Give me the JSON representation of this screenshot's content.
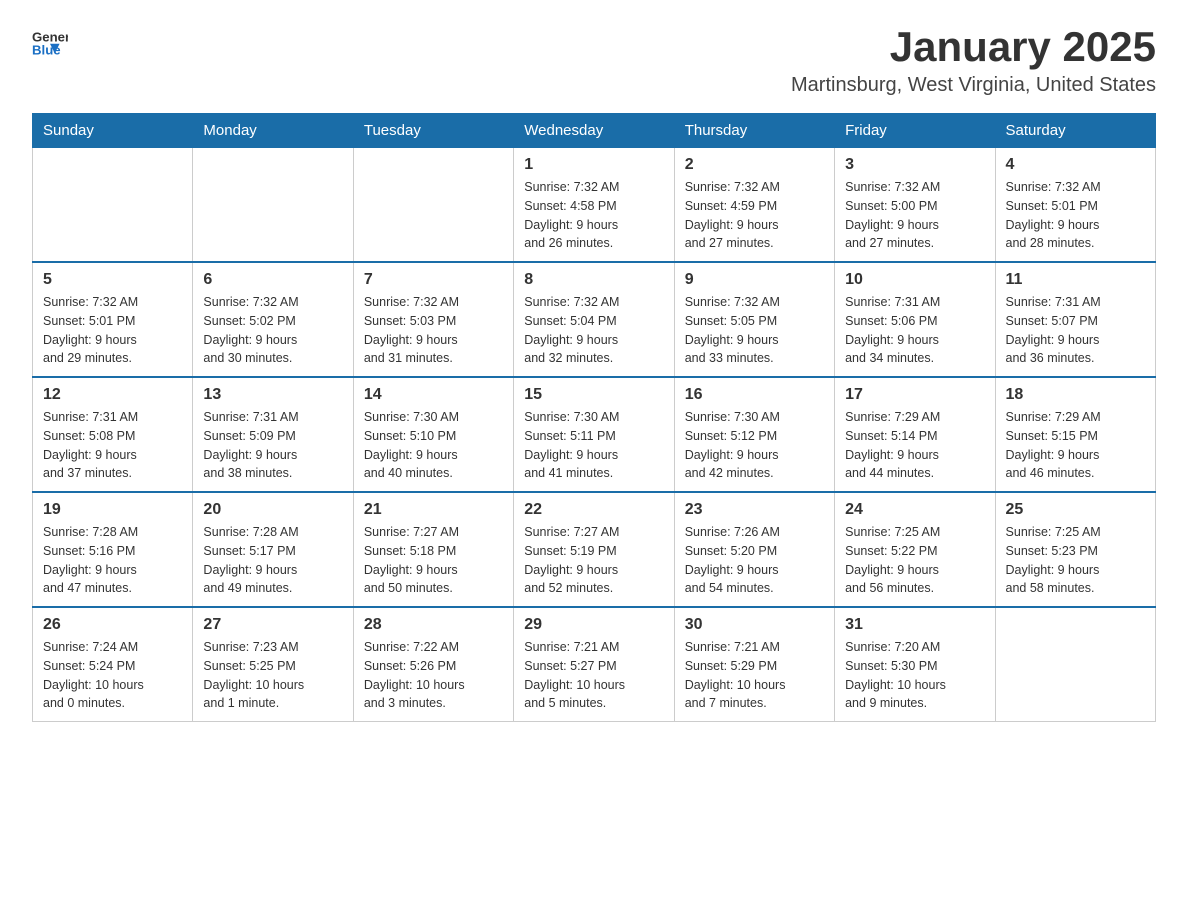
{
  "header": {
    "logo_general": "General",
    "logo_blue": "Blue",
    "month_title": "January 2025",
    "location": "Martinsburg, West Virginia, United States"
  },
  "weekdays": [
    "Sunday",
    "Monday",
    "Tuesday",
    "Wednesday",
    "Thursday",
    "Friday",
    "Saturday"
  ],
  "weeks": [
    [
      {
        "day": "",
        "info": ""
      },
      {
        "day": "",
        "info": ""
      },
      {
        "day": "",
        "info": ""
      },
      {
        "day": "1",
        "info": "Sunrise: 7:32 AM\nSunset: 4:58 PM\nDaylight: 9 hours\nand 26 minutes."
      },
      {
        "day": "2",
        "info": "Sunrise: 7:32 AM\nSunset: 4:59 PM\nDaylight: 9 hours\nand 27 minutes."
      },
      {
        "day": "3",
        "info": "Sunrise: 7:32 AM\nSunset: 5:00 PM\nDaylight: 9 hours\nand 27 minutes."
      },
      {
        "day": "4",
        "info": "Sunrise: 7:32 AM\nSunset: 5:01 PM\nDaylight: 9 hours\nand 28 minutes."
      }
    ],
    [
      {
        "day": "5",
        "info": "Sunrise: 7:32 AM\nSunset: 5:01 PM\nDaylight: 9 hours\nand 29 minutes."
      },
      {
        "day": "6",
        "info": "Sunrise: 7:32 AM\nSunset: 5:02 PM\nDaylight: 9 hours\nand 30 minutes."
      },
      {
        "day": "7",
        "info": "Sunrise: 7:32 AM\nSunset: 5:03 PM\nDaylight: 9 hours\nand 31 minutes."
      },
      {
        "day": "8",
        "info": "Sunrise: 7:32 AM\nSunset: 5:04 PM\nDaylight: 9 hours\nand 32 minutes."
      },
      {
        "day": "9",
        "info": "Sunrise: 7:32 AM\nSunset: 5:05 PM\nDaylight: 9 hours\nand 33 minutes."
      },
      {
        "day": "10",
        "info": "Sunrise: 7:31 AM\nSunset: 5:06 PM\nDaylight: 9 hours\nand 34 minutes."
      },
      {
        "day": "11",
        "info": "Sunrise: 7:31 AM\nSunset: 5:07 PM\nDaylight: 9 hours\nand 36 minutes."
      }
    ],
    [
      {
        "day": "12",
        "info": "Sunrise: 7:31 AM\nSunset: 5:08 PM\nDaylight: 9 hours\nand 37 minutes."
      },
      {
        "day": "13",
        "info": "Sunrise: 7:31 AM\nSunset: 5:09 PM\nDaylight: 9 hours\nand 38 minutes."
      },
      {
        "day": "14",
        "info": "Sunrise: 7:30 AM\nSunset: 5:10 PM\nDaylight: 9 hours\nand 40 minutes."
      },
      {
        "day": "15",
        "info": "Sunrise: 7:30 AM\nSunset: 5:11 PM\nDaylight: 9 hours\nand 41 minutes."
      },
      {
        "day": "16",
        "info": "Sunrise: 7:30 AM\nSunset: 5:12 PM\nDaylight: 9 hours\nand 42 minutes."
      },
      {
        "day": "17",
        "info": "Sunrise: 7:29 AM\nSunset: 5:14 PM\nDaylight: 9 hours\nand 44 minutes."
      },
      {
        "day": "18",
        "info": "Sunrise: 7:29 AM\nSunset: 5:15 PM\nDaylight: 9 hours\nand 46 minutes."
      }
    ],
    [
      {
        "day": "19",
        "info": "Sunrise: 7:28 AM\nSunset: 5:16 PM\nDaylight: 9 hours\nand 47 minutes."
      },
      {
        "day": "20",
        "info": "Sunrise: 7:28 AM\nSunset: 5:17 PM\nDaylight: 9 hours\nand 49 minutes."
      },
      {
        "day": "21",
        "info": "Sunrise: 7:27 AM\nSunset: 5:18 PM\nDaylight: 9 hours\nand 50 minutes."
      },
      {
        "day": "22",
        "info": "Sunrise: 7:27 AM\nSunset: 5:19 PM\nDaylight: 9 hours\nand 52 minutes."
      },
      {
        "day": "23",
        "info": "Sunrise: 7:26 AM\nSunset: 5:20 PM\nDaylight: 9 hours\nand 54 minutes."
      },
      {
        "day": "24",
        "info": "Sunrise: 7:25 AM\nSunset: 5:22 PM\nDaylight: 9 hours\nand 56 minutes."
      },
      {
        "day": "25",
        "info": "Sunrise: 7:25 AM\nSunset: 5:23 PM\nDaylight: 9 hours\nand 58 minutes."
      }
    ],
    [
      {
        "day": "26",
        "info": "Sunrise: 7:24 AM\nSunset: 5:24 PM\nDaylight: 10 hours\nand 0 minutes."
      },
      {
        "day": "27",
        "info": "Sunrise: 7:23 AM\nSunset: 5:25 PM\nDaylight: 10 hours\nand 1 minute."
      },
      {
        "day": "28",
        "info": "Sunrise: 7:22 AM\nSunset: 5:26 PM\nDaylight: 10 hours\nand 3 minutes."
      },
      {
        "day": "29",
        "info": "Sunrise: 7:21 AM\nSunset: 5:27 PM\nDaylight: 10 hours\nand 5 minutes."
      },
      {
        "day": "30",
        "info": "Sunrise: 7:21 AM\nSunset: 5:29 PM\nDaylight: 10 hours\nand 7 minutes."
      },
      {
        "day": "31",
        "info": "Sunrise: 7:20 AM\nSunset: 5:30 PM\nDaylight: 10 hours\nand 9 minutes."
      },
      {
        "day": "",
        "info": ""
      }
    ]
  ]
}
